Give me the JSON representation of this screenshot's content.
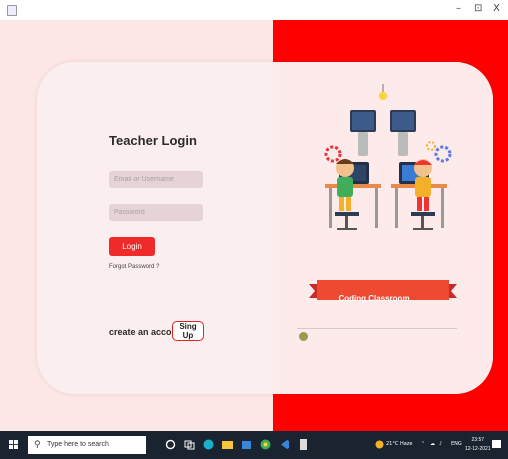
{
  "window": {
    "controls": {
      "minimize": "–",
      "maximize": "⊡",
      "close": "X"
    }
  },
  "login": {
    "title": "Teacher Login",
    "email_placeholder": "Email or Username",
    "password_placeholder": "Password",
    "login_label": "Login",
    "forgot_label": "Forgot Password ?",
    "create_label": "create an account ?",
    "signup_label": "Sing Up"
  },
  "illustration": {
    "banner_text": "Coding Classroom"
  },
  "colors": {
    "accent": "#ff0000",
    "button": "#ee2a2a",
    "left_bg": "#fde6e6"
  },
  "taskbar": {
    "search_placeholder": "Type here to search",
    "weather": "21°C  Haze",
    "language": "ENG",
    "time": "23:57",
    "date": "12-12-2021"
  }
}
